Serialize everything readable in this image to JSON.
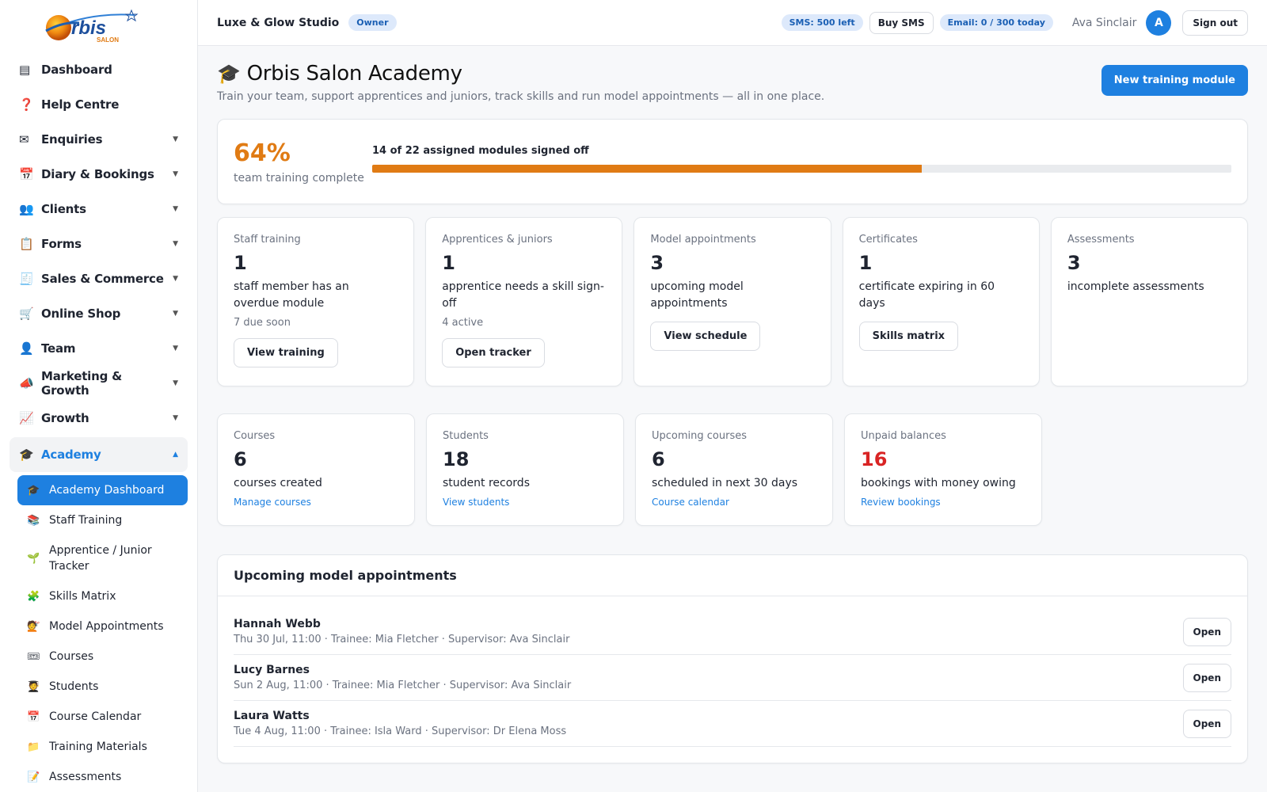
{
  "brand": {
    "logo_text": "rbis",
    "logo_initial": "O",
    "logo_sub": "SALON"
  },
  "sidebar": {
    "items": [
      {
        "label": "Dashboard",
        "icon": "▤",
        "icon_name": "dashboard-icon"
      },
      {
        "label": "Help Centre",
        "icon": "❓",
        "icon_name": "help-icon"
      },
      {
        "label": "Enquiries",
        "icon": "✉",
        "icon_name": "envelope-icon",
        "chevron": "▼"
      },
      {
        "label": "Diary & Bookings",
        "icon": "📅",
        "icon_name": "calendar-icon",
        "chevron": "▼"
      },
      {
        "label": "Clients",
        "icon": "👥",
        "icon_name": "clients-icon",
        "chevron": "▼"
      },
      {
        "label": "Forms",
        "icon": "📋",
        "icon_name": "clipboard-icon",
        "chevron": "▼"
      },
      {
        "label": "Sales & Commerce",
        "icon": "🧾",
        "icon_name": "receipt-icon",
        "chevron": "▼"
      },
      {
        "label": "Online Shop",
        "icon": "🛒",
        "icon_name": "cart-icon",
        "chevron": "▼"
      },
      {
        "label": "Team",
        "icon": "👤",
        "icon_name": "person-icon",
        "chevron": "▼"
      },
      {
        "label": "Marketing & Growth",
        "icon": "📣",
        "icon_name": "megaphone-icon",
        "chevron": "▼"
      },
      {
        "label": "Growth",
        "icon": "📈",
        "icon_name": "chart-up-icon",
        "chevron": "▼"
      }
    ],
    "academy": {
      "label": "Academy",
      "icon": "🎓",
      "chevron": "▲"
    },
    "academy_sub": [
      {
        "label": "Academy Dashboard",
        "icon": "🎓",
        "icon_name": "graduation-cap-icon"
      },
      {
        "label": "Staff Training",
        "icon": "📚",
        "icon_name": "books-icon"
      },
      {
        "label": "Apprentice / Junior Tracker",
        "icon": "🌱",
        "icon_name": "seedling-icon"
      },
      {
        "label": "Skills Matrix",
        "icon": "🧩",
        "icon_name": "puzzle-icon"
      },
      {
        "label": "Model Appointments",
        "icon": "💇",
        "icon_name": "haircut-icon"
      },
      {
        "label": "Courses",
        "icon": "🎟",
        "icon_name": "ticket-icon"
      },
      {
        "label": "Students",
        "icon": "🧑‍🎓",
        "icon_name": "student-icon"
      },
      {
        "label": "Course Calendar",
        "icon": "📅",
        "icon_name": "calendar-icon"
      },
      {
        "label": "Training Materials",
        "icon": "📁",
        "icon_name": "folder-icon"
      },
      {
        "label": "Assessments",
        "icon": "📝",
        "icon_name": "memo-icon"
      }
    ]
  },
  "topbar": {
    "studio": "Luxe & Glow Studio",
    "role": "Owner",
    "sms": "SMS: 500 left",
    "buy_sms": "Buy SMS",
    "email": "Email: 0 / 300 today",
    "user": "Ava Sinclair",
    "avatar": "A",
    "sign_out": "Sign out"
  },
  "page": {
    "title_icon": "🎓",
    "title": "Orbis Salon Academy",
    "subtitle": "Train your team, support apprentices and juniors, track skills and run model appointments — all in one place.",
    "new_module": "New training module"
  },
  "progress": {
    "percent_label": "64%",
    "caption": "team training complete",
    "label": "14 of 22 assigned modules signed off",
    "fraction": 0.64
  },
  "stats_row1": [
    {
      "label": "Staff training",
      "number": "1",
      "desc": "staff member has an overdue module",
      "meta": "7 due soon",
      "button": "View training"
    },
    {
      "label": "Apprentices & juniors",
      "number": "1",
      "desc": "apprentice needs a skill sign-off",
      "meta": "4 active",
      "button": "Open tracker"
    },
    {
      "label": "Model appointments",
      "number": "3",
      "desc": "upcoming model appointments",
      "button": "View schedule"
    },
    {
      "label": "Certificates",
      "number": "1",
      "desc": "certificate expiring in 60 days",
      "button": "Skills matrix"
    },
    {
      "label": "Assessments",
      "number": "3",
      "desc": "incomplete assessments"
    }
  ],
  "stats_row2": [
    {
      "label": "Courses",
      "number": "6",
      "desc": "courses created",
      "link": "Manage courses"
    },
    {
      "label": "Students",
      "number": "18",
      "desc": "student records",
      "link": "View students"
    },
    {
      "label": "Upcoming courses",
      "number": "6",
      "desc": "scheduled in next 30 days",
      "link": "Course calendar"
    },
    {
      "label": "Unpaid balances",
      "number": "16",
      "desc": "bookings with money owing",
      "link": "Review bookings",
      "alert": true
    }
  ],
  "appointments": {
    "title": "Upcoming model appointments",
    "open_label": "Open",
    "rows": [
      {
        "name": "Hannah Webb",
        "meta": "Thu 30 Jul, 11:00 · Trainee: Mia Fletcher · Supervisor: Ava Sinclair"
      },
      {
        "name": "Lucy Barnes",
        "meta": "Sun 2 Aug, 11:00 · Trainee: Mia Fletcher · Supervisor: Ava Sinclair"
      },
      {
        "name": "Laura Watts",
        "meta": "Tue 4 Aug, 11:00 · Trainee: Isla Ward · Supervisor: Dr Elena Moss"
      }
    ]
  },
  "colors": {
    "accent": "#1e80e0",
    "progress": "#e07b14",
    "alert": "#d92424"
  }
}
